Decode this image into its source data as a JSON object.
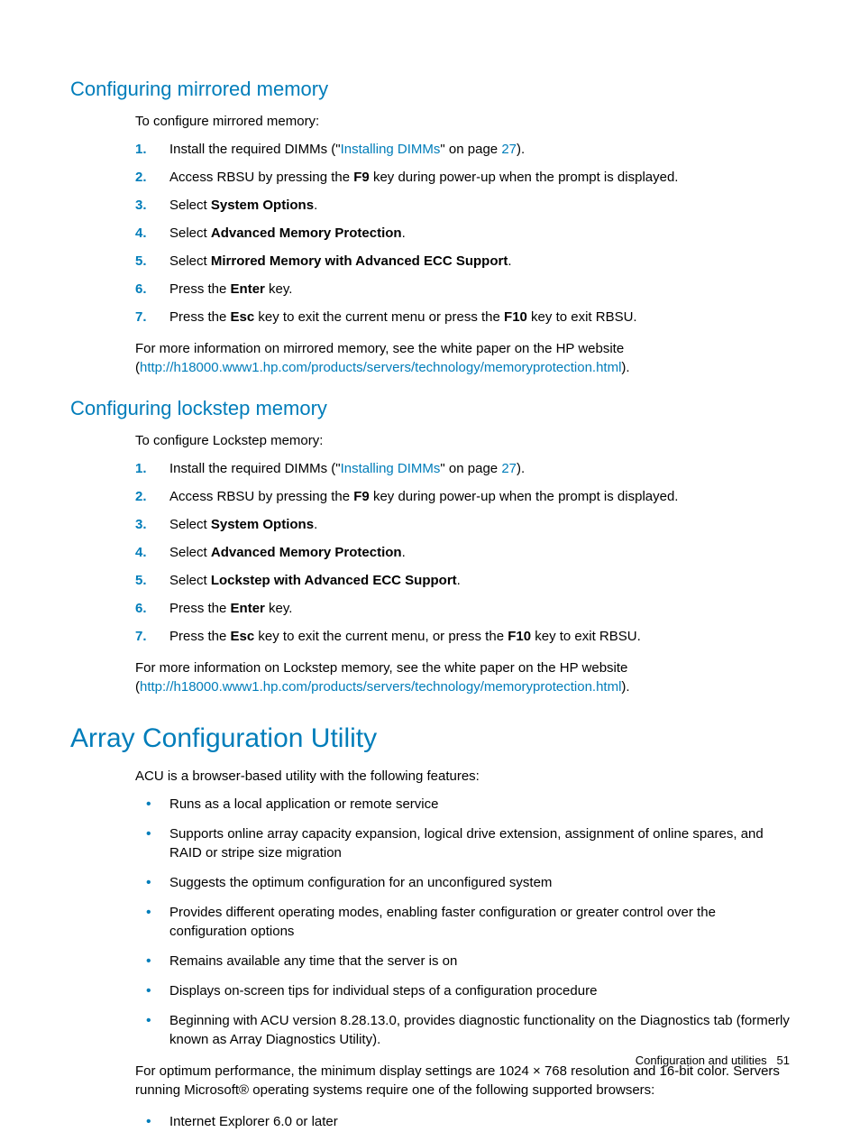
{
  "sec1": {
    "title": "Configuring mirrored memory",
    "intro": "To configure mirrored memory:",
    "steps": {
      "n1": "1.",
      "s1a": "Install the required DIMMs (\"",
      "s1link": "Installing DIMMs",
      "s1b": "\" on page ",
      "s1page": "27",
      "s1c": ").",
      "n2": "2.",
      "s2a": "Access RBSU by pressing the ",
      "s2b": "F9",
      "s2c": " key during power-up when the prompt is displayed.",
      "n3": "3.",
      "s3a": "Select ",
      "s3b": "System Options",
      "s3c": ".",
      "n4": "4.",
      "s4a": "Select ",
      "s4b": "Advanced Memory Protection",
      "s4c": ".",
      "n5": "5.",
      "s5a": "Select ",
      "s5b": "Mirrored Memory with Advanced ECC Support",
      "s5c": ".",
      "n6": "6.",
      "s6a": "Press the ",
      "s6b": "Enter",
      "s6c": " key.",
      "n7": "7.",
      "s7a": "Press the ",
      "s7b": "Esc",
      "s7c": " key to exit the current menu or press the ",
      "s7d": "F10",
      "s7e": " key to exit RBSU."
    },
    "post1": "For more information on mirrored memory, see the white paper on the HP website (",
    "postlink": "http://h18000.www1.hp.com/products/servers/technology/memoryprotection.html",
    "post2": ")."
  },
  "sec2": {
    "title": "Configuring lockstep memory",
    "intro": "To configure Lockstep memory:",
    "steps": {
      "n1": "1.",
      "s1a": "Install the required DIMMs (\"",
      "s1link": "Installing DIMMs",
      "s1b": "\" on page ",
      "s1page": "27",
      "s1c": ").",
      "n2": "2.",
      "s2a": "Access RBSU by pressing the ",
      "s2b": "F9",
      "s2c": " key during power-up when the prompt is displayed.",
      "n3": "3.",
      "s3a": "Select ",
      "s3b": "System Options",
      "s3c": ".",
      "n4": "4.",
      "s4a": "Select ",
      "s4b": "Advanced Memory Protection",
      "s4c": ".",
      "n5": "5.",
      "s5a": "Select ",
      "s5b": "Lockstep with Advanced ECC Support",
      "s5c": ".",
      "n6": "6.",
      "s6a": "Press the ",
      "s6b": "Enter",
      "s6c": " key.",
      "n7": "7.",
      "s7a": "Press the ",
      "s7b": "Esc",
      "s7c": " key to exit the current menu, or press the ",
      "s7d": "F10",
      "s7e": " key to exit RBSU."
    },
    "post1": "For more information on Lockstep memory, see the white paper on the HP website (",
    "postlink": "http://h18000.www1.hp.com/products/servers/technology/memoryprotection.html",
    "post2": ")."
  },
  "sec3": {
    "title": "Array Configuration Utility",
    "intro": "ACU is a browser-based utility with the following features:",
    "bullets": {
      "b1": "Runs as a local application or remote service",
      "b2": "Supports online array capacity expansion, logical drive extension, assignment of online spares, and RAID or stripe size migration",
      "b3": "Suggests the optimum configuration for an unconfigured system",
      "b4": "Provides different operating modes, enabling faster configuration or greater control over the configuration options",
      "b5": "Remains available any time that the server is on",
      "b6": "Displays on-screen tips for individual steps of a configuration procedure",
      "b7": "Beginning with ACU version 8.28.13.0, provides diagnostic functionality on the Diagnostics tab (formerly known as Array Diagnostics Utility)."
    },
    "post": "For optimum performance, the minimum display settings are 1024 × 768 resolution and 16-bit color. Servers running Microsoft® operating systems require one of the following supported browsers:",
    "bullets2": {
      "b1": "Internet Explorer 6.0 or later"
    }
  },
  "footer": {
    "section": "Configuration and utilities",
    "page": "51"
  }
}
